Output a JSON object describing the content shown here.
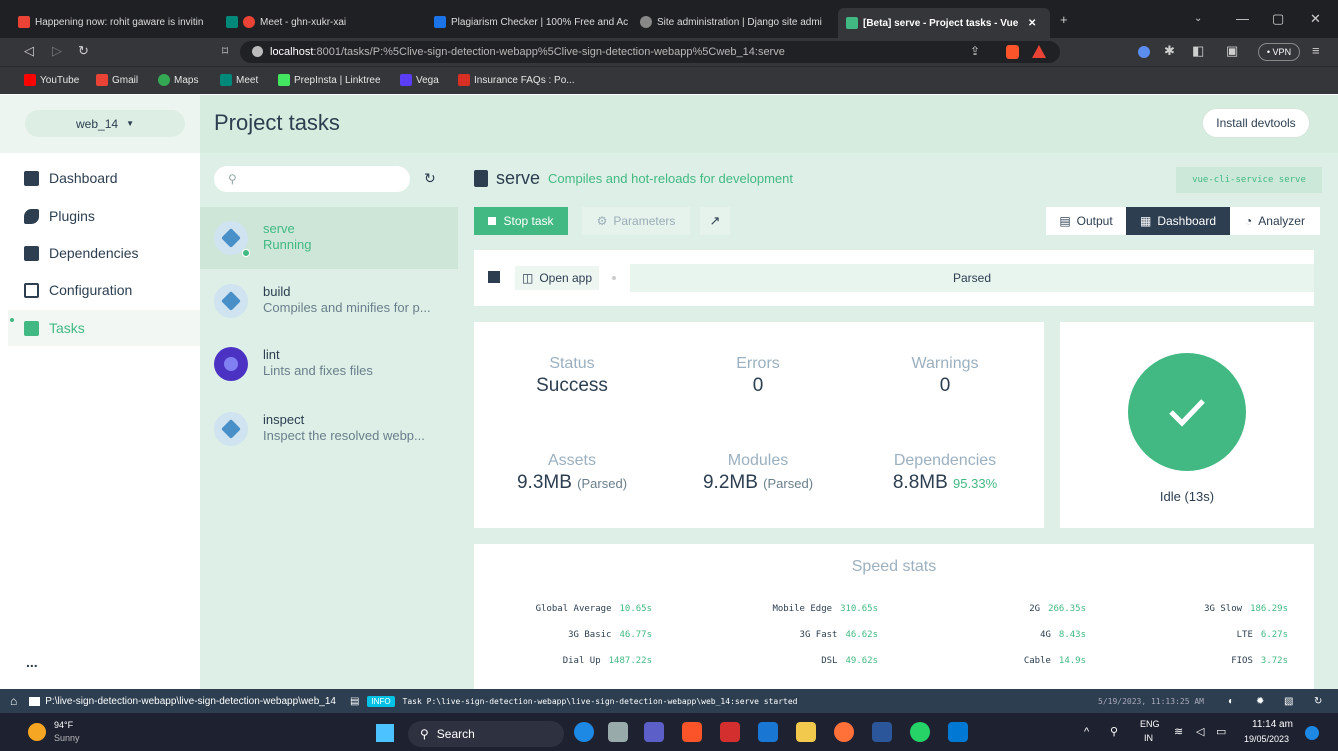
{
  "browser": {
    "tabs": [
      {
        "label": "Happening now: rohit gaware is invitin",
        "color": "#ea4335"
      },
      {
        "label": "Meet - ghn-xukr-xai",
        "color": "#00897b"
      },
      {
        "label": "Plagiarism Checker | 100% Free and Ac",
        "color": "#1a73e8"
      },
      {
        "label": "Site administration | Django site admi",
        "color": "#888888"
      },
      {
        "label": "[Beta] serve - Project tasks - Vue",
        "color": "#42b983"
      }
    ],
    "url_host": "localhost",
    "url_rest": ":8001/tasks/P:%5Clive-sign-detection-webapp%5Clive-sign-detection-webapp%5Cweb_14:serve",
    "vpn_label": "• VPN",
    "bookmarks": [
      "YouTube",
      "Gmail",
      "Maps",
      "Meet",
      "PrepInsta | Linktree",
      "Vega",
      "Insurance FAQs : Po..."
    ]
  },
  "sidebar": {
    "project": "web_14",
    "items": [
      {
        "label": "Dashboard"
      },
      {
        "label": "Plugins"
      },
      {
        "label": "Dependencies"
      },
      {
        "label": "Configuration"
      },
      {
        "label": "Tasks"
      }
    ],
    "more": "..."
  },
  "header": {
    "title": "Project tasks",
    "devtools": "Install devtools"
  },
  "tasks": [
    {
      "name": "serve",
      "desc": "Running"
    },
    {
      "name": "build",
      "desc": "Compiles and minifies for p..."
    },
    {
      "name": "lint",
      "desc": "Lints and fixes files"
    },
    {
      "name": "inspect",
      "desc": "Inspect the resolved webp..."
    }
  ],
  "task": {
    "name": "serve",
    "desc": "Compiles and hot-reloads for development",
    "command": "vue-cli-service serve",
    "stop": "Stop task",
    "params": "Parameters",
    "views": [
      "Output",
      "Dashboard",
      "Analyzer"
    ],
    "open_app": "Open app",
    "mode": "Parsed"
  },
  "stats": {
    "status_label": "Status",
    "status": "Success",
    "errors_label": "Errors",
    "errors": "0",
    "warnings_label": "Warnings",
    "warnings": "0",
    "assets_label": "Assets",
    "assets": "9.3MB",
    "assets_note": "(Parsed)",
    "modules_label": "Modules",
    "modules": "9.2MB",
    "modules_note": "(Parsed)",
    "deps_label": "Dependencies",
    "deps": "8.8MB",
    "deps_note": "95.33%",
    "idle": "Idle (13s)"
  },
  "speed": {
    "title": "Speed stats",
    "rows": [
      [
        {
          "k": "Global Average",
          "v": "10.65s"
        },
        {
          "k": "Mobile Edge",
          "v": "310.65s"
        },
        {
          "k": "2G",
          "v": "266.35s"
        },
        {
          "k": "3G Slow",
          "v": "186.29s"
        }
      ],
      [
        {
          "k": "3G Basic",
          "v": "46.77s"
        },
        {
          "k": "3G Fast",
          "v": "46.62s"
        },
        {
          "k": "4G",
          "v": "8.43s"
        },
        {
          "k": "LTE",
          "v": "6.27s"
        }
      ],
      [
        {
          "k": "Dial Up",
          "v": "1487.22s"
        },
        {
          "k": "DSL",
          "v": "49.62s"
        },
        {
          "k": "Cable",
          "v": "14.9s"
        },
        {
          "k": "FIOS",
          "v": "3.72s"
        }
      ]
    ]
  },
  "statusbar": {
    "path": "P:\\live-sign-detection-webapp\\live-sign-detection-webapp\\web_14",
    "badge": "INFO",
    "log": "Task P:\\live-sign-detection-webapp\\live-sign-detection-webapp\\web_14:serve started",
    "time": "5/19/2023, 11:13:25 AM"
  },
  "taskbar": {
    "temp": "94°F",
    "weather": "Sunny",
    "search": "Search",
    "lang1": "ENG",
    "lang2": "IN",
    "clock": "11:14 am",
    "date": "19/05/2023"
  }
}
